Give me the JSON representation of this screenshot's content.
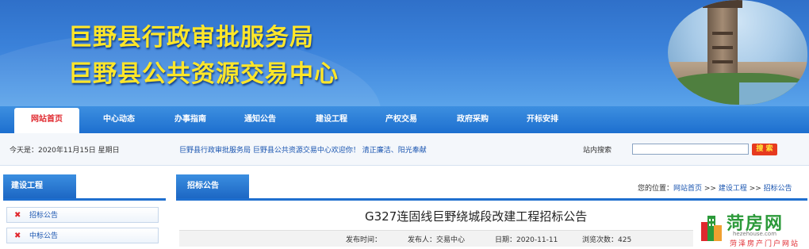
{
  "header": {
    "title_line1": "巨野县行政审批服务局",
    "title_line2": "巨野县公共资源交易中心"
  },
  "nav": {
    "items": [
      {
        "label": "网站首页",
        "active": true
      },
      {
        "label": "中心动态"
      },
      {
        "label": "办事指南"
      },
      {
        "label": "通知公告"
      },
      {
        "label": "建设工程"
      },
      {
        "label": "产权交易"
      },
      {
        "label": "政府采购"
      },
      {
        "label": "开标安排"
      }
    ]
  },
  "infobar": {
    "date": "今天是：2020年11月15日  星期日",
    "marquee": "巨野县行政审批服务局  巨野县公共资源交易中心欢迎你！  清正廉洁、阳光奉献",
    "search_label": "站内搜索",
    "search_value": "",
    "search_button": "搜 索"
  },
  "sidebar": {
    "title": "建设工程",
    "items": [
      {
        "label": "招标公告"
      },
      {
        "label": "中标公告"
      }
    ]
  },
  "main": {
    "tab_title": "招标公告",
    "breadcrumb_prefix": "您的位置：",
    "breadcrumb": [
      "网站首页",
      "建设工程",
      "招标公告"
    ],
    "breadcrumb_sep": " >> ",
    "article_title": "G327连固线巨野绕城段改建工程招标公告",
    "meta": {
      "publish_label": "发布时间：",
      "publisher": "发布人：交易中心",
      "date": "日期：2020-11-11",
      "views": "浏览次数：425"
    }
  },
  "watermark": {
    "name": "菏房网",
    "url": "hezehouse.com",
    "subtitle": "菏泽房产门户网站"
  },
  "colors": {
    "banner_blue": "#3b82da",
    "title_yellow": "#ffe629",
    "nav_blue": "#1d6fcf",
    "active_red": "#e0282e",
    "link_blue": "#1a55b0",
    "watermark_green": "#2c9a3a"
  }
}
